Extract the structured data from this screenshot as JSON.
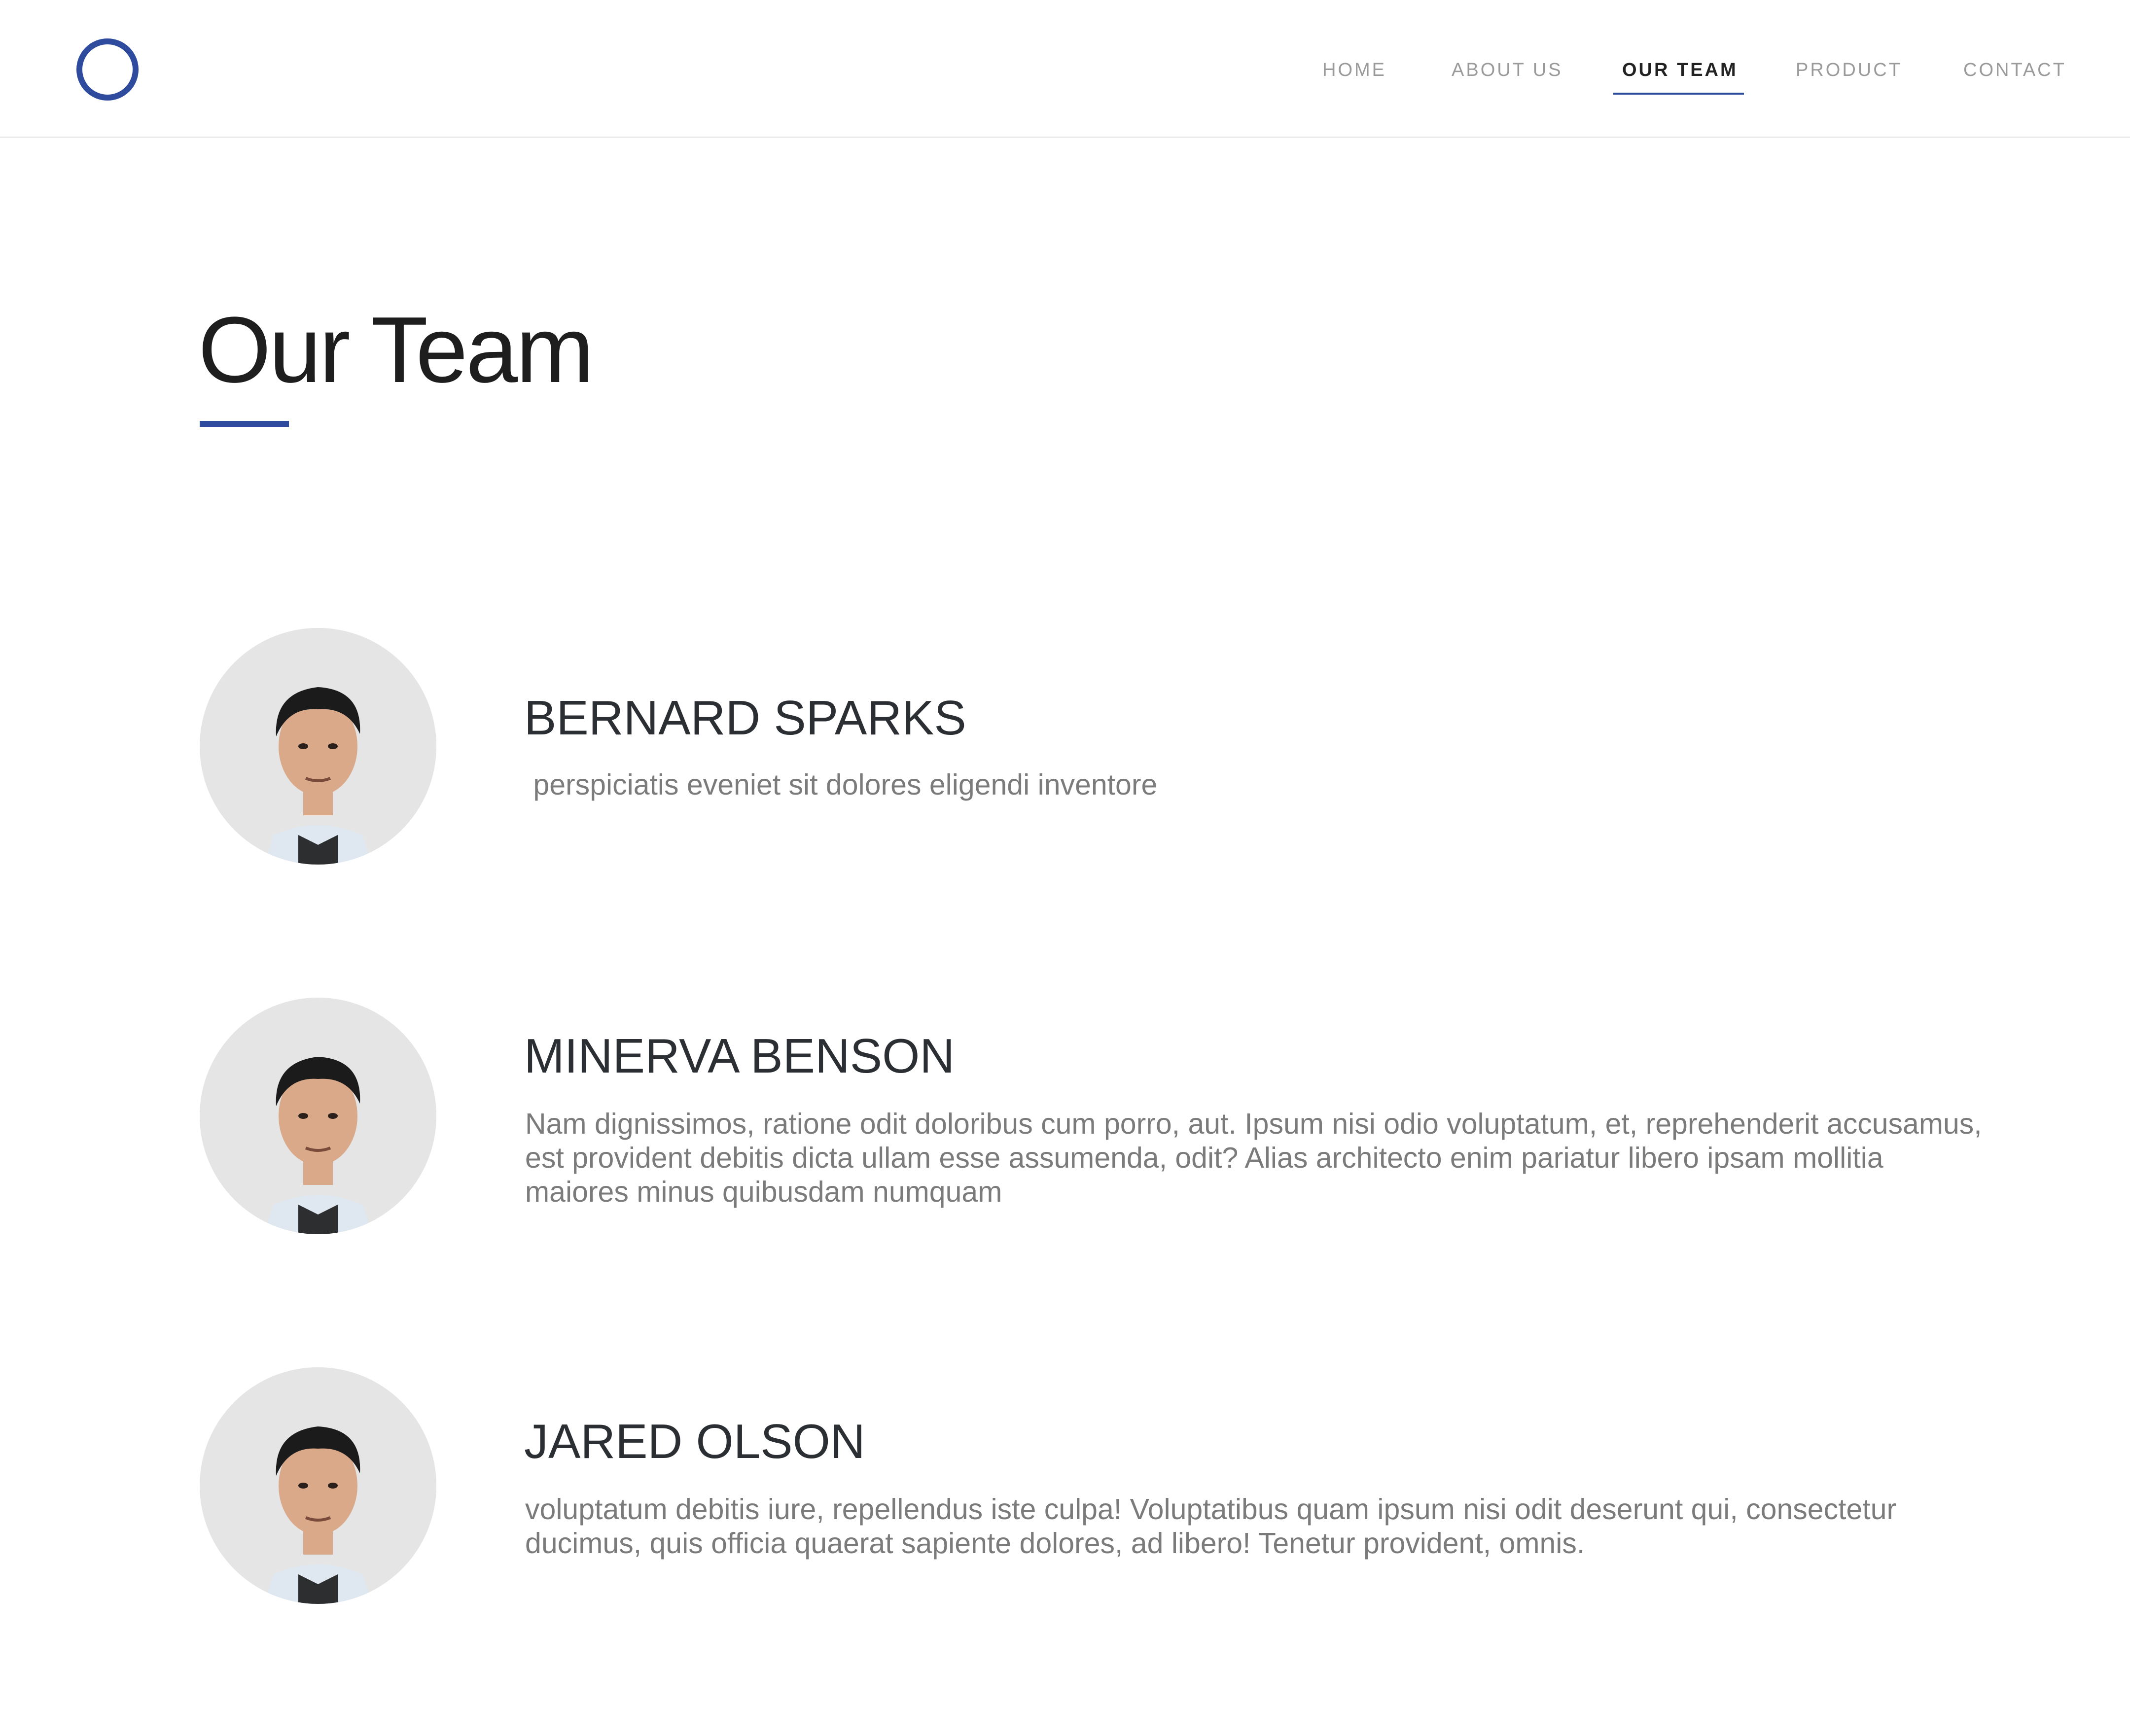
{
  "header": {
    "nav": [
      {
        "label": "HOME",
        "active": false
      },
      {
        "label": "ABOUT US",
        "active": false
      },
      {
        "label": "OUR TEAM",
        "active": true
      },
      {
        "label": "PRODUCT",
        "active": false
      },
      {
        "label": "CONTACT",
        "active": false
      }
    ]
  },
  "main": {
    "title": "Our Team",
    "members": [
      {
        "name": "BERNARD SPARKS",
        "description": " perspiciatis eveniet sit dolores eligendi inventore"
      },
      {
        "name": "MINERVA BENSON",
        "description": "Nam dignissimos, ratione odit doloribus cum porro, aut. Ipsum nisi odio voluptatum, et, reprehenderit accusamus, est provident debitis dicta ullam esse assumenda, odit? Alias architecto enim pariatur libero ipsam mollitia maiores minus quibusdam numquam"
      },
      {
        "name": "JARED OLSON",
        "description": "voluptatum debitis iure, repellendus iste culpa! Voluptatibus quam ipsum nisi odit deserunt qui, consectetur ducimus, quis officia quaerat sapiente dolores, ad libero! Tenetur provident, omnis."
      }
    ]
  },
  "colors": {
    "accent": "#2f4b9d",
    "heading": "#1e1e1e",
    "body_text": "#7b7b7b",
    "nav_inactive": "#9a9a9a"
  },
  "icons": {
    "logo": "ring-logo-icon",
    "avatar": "person-photo"
  }
}
